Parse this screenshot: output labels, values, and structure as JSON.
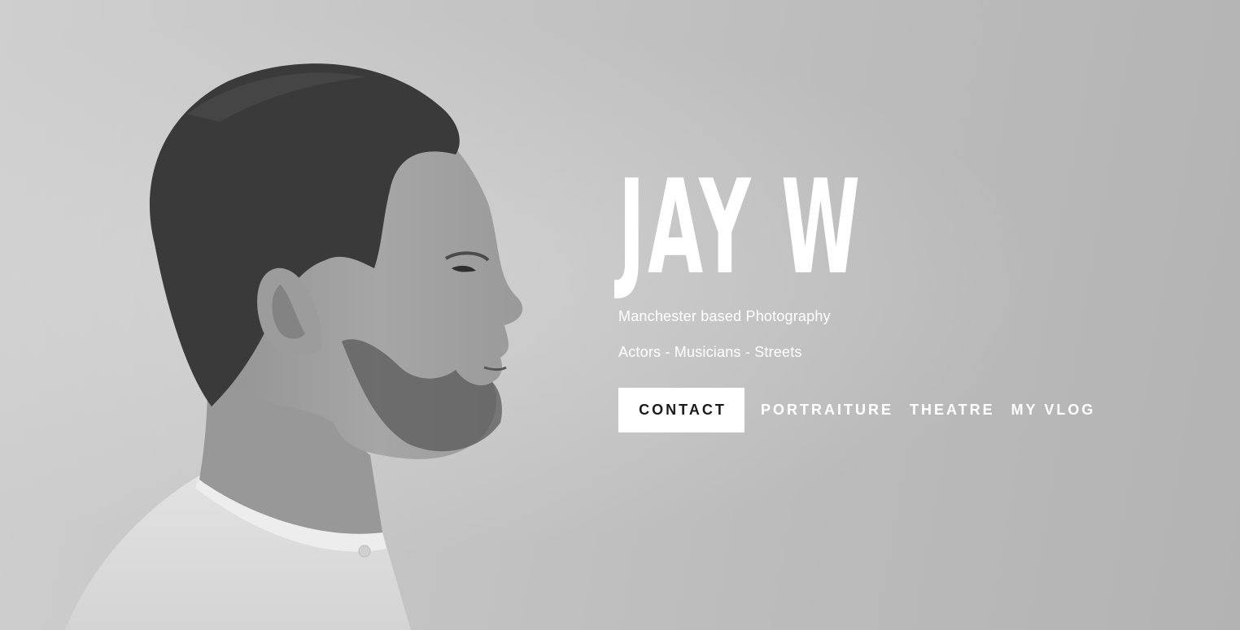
{
  "site": {
    "title": "JAY W",
    "tagline_1": "Manchester based Photography",
    "tagline_2": "Actors - Musicians - Streets"
  },
  "nav": {
    "contact": "CONTACT",
    "links": [
      "PORTRAITURE",
      "THEATRE",
      "MY VLOG"
    ]
  },
  "hero_image": {
    "description_icon": "portrait-photo",
    "style": "black-and-white"
  },
  "colors": {
    "text": "#ffffff",
    "button_bg": "#ffffff",
    "button_text": "#1a1a1a"
  }
}
